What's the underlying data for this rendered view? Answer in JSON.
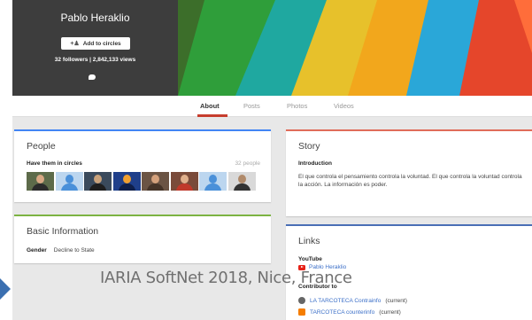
{
  "profile": {
    "name": "Pablo Heraklio",
    "add_button": "Add to circles",
    "followers_line": "32 followers | 2,842,133 views"
  },
  "tabs": [
    {
      "label": "About",
      "active": true
    },
    {
      "label": "Posts"
    },
    {
      "label": "Photos"
    },
    {
      "label": "Videos"
    }
  ],
  "people": {
    "title": "People",
    "subtitle": "Have them in circles",
    "count": "32 people"
  },
  "basic_info": {
    "title": "Basic Information",
    "gender_label": "Gender",
    "gender_value": "Decline to State"
  },
  "story": {
    "title": "Story",
    "subtitle": "Introduction",
    "text": "El que controla el pensamiento controla la voluntad. El que controla la voluntad controla la acción. La información es poder."
  },
  "links": {
    "title": "Links",
    "youtube_label": "YouTube",
    "youtube_link": "Pablo Heraklio",
    "contributor_label": "Contributor to",
    "contrib1_link": "LA TARCOTECA Contrainfo",
    "contrib1_status": "(current)",
    "contrib2_link": "TARCOTECA counterinfo",
    "contrib2_status": "(current)"
  },
  "caption": "IARIA SoftNet 2018, Nice, France",
  "colors": {
    "accent_tab": "#c63d2d",
    "people_border": "#4285f4",
    "basic_border": "#7cb342",
    "story_border": "#e06c5a",
    "links_border": "#4a6fb5",
    "link_text": "#3b6fc8"
  }
}
